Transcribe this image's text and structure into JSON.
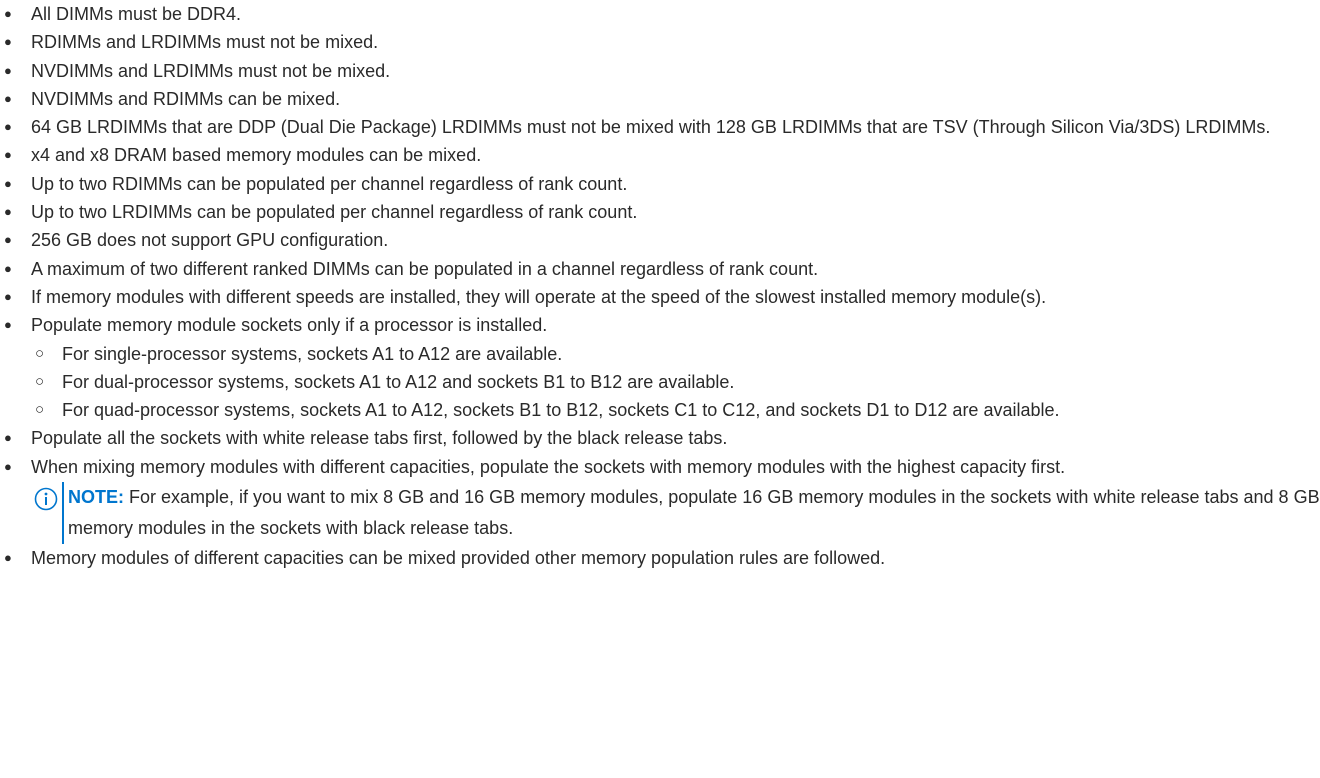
{
  "rules": [
    "All DIMMs must be DDR4.",
    "RDIMMs and LRDIMMs must not be mixed.",
    "NVDIMMs and LRDIMMs must not be mixed.",
    "NVDIMMs and RDIMMs can be mixed.",
    "64 GB LRDIMMs that are DDP (Dual Die Package) LRDIMMs must not be mixed with 128 GB LRDIMMs that are TSV (Through Silicon Via/3DS) LRDIMMs.",
    "x4 and x8 DRAM based memory modules can be mixed.",
    "Up to two RDIMMs can be populated per channel regardless of rank count.",
    "Up to two LRDIMMs can be populated per channel regardless of rank count.",
    "256 GB does not support GPU configuration.",
    "A maximum of two different ranked DIMMs can be populated in a channel regardless of rank count.",
    "If memory modules with different speeds are installed, they will operate at the speed of the slowest installed memory module(s).",
    "Populate memory module sockets only if a processor is installed.",
    "Populate all the sockets with white release tabs first, followed by the black release tabs.",
    "When mixing memory modules with different capacities, populate the sockets with memory modules with the highest capacity first.",
    "Memory modules of different capacities can be mixed provided other memory population rules are followed."
  ],
  "processor_sockets": [
    "For single-processor systems, sockets A1 to A12 are available.",
    "For dual-processor systems, sockets A1 to A12 and sockets B1 to B12 are available.",
    "For quad-processor systems, sockets A1 to A12, sockets B1 to B12, sockets C1 to C12, and sockets D1 to D12 are available."
  ],
  "note": {
    "label": "NOTE:",
    "text": "For example, if you want to mix 8 GB and 16 GB memory modules, populate 16 GB memory modules in the sockets with white release tabs and 8 GB memory modules in the sockets with black release tabs.",
    "icon": "info-icon",
    "accent_color": "#0076ce"
  },
  "bullet_glyphs": {
    "primary": "●",
    "secondary": "○"
  }
}
